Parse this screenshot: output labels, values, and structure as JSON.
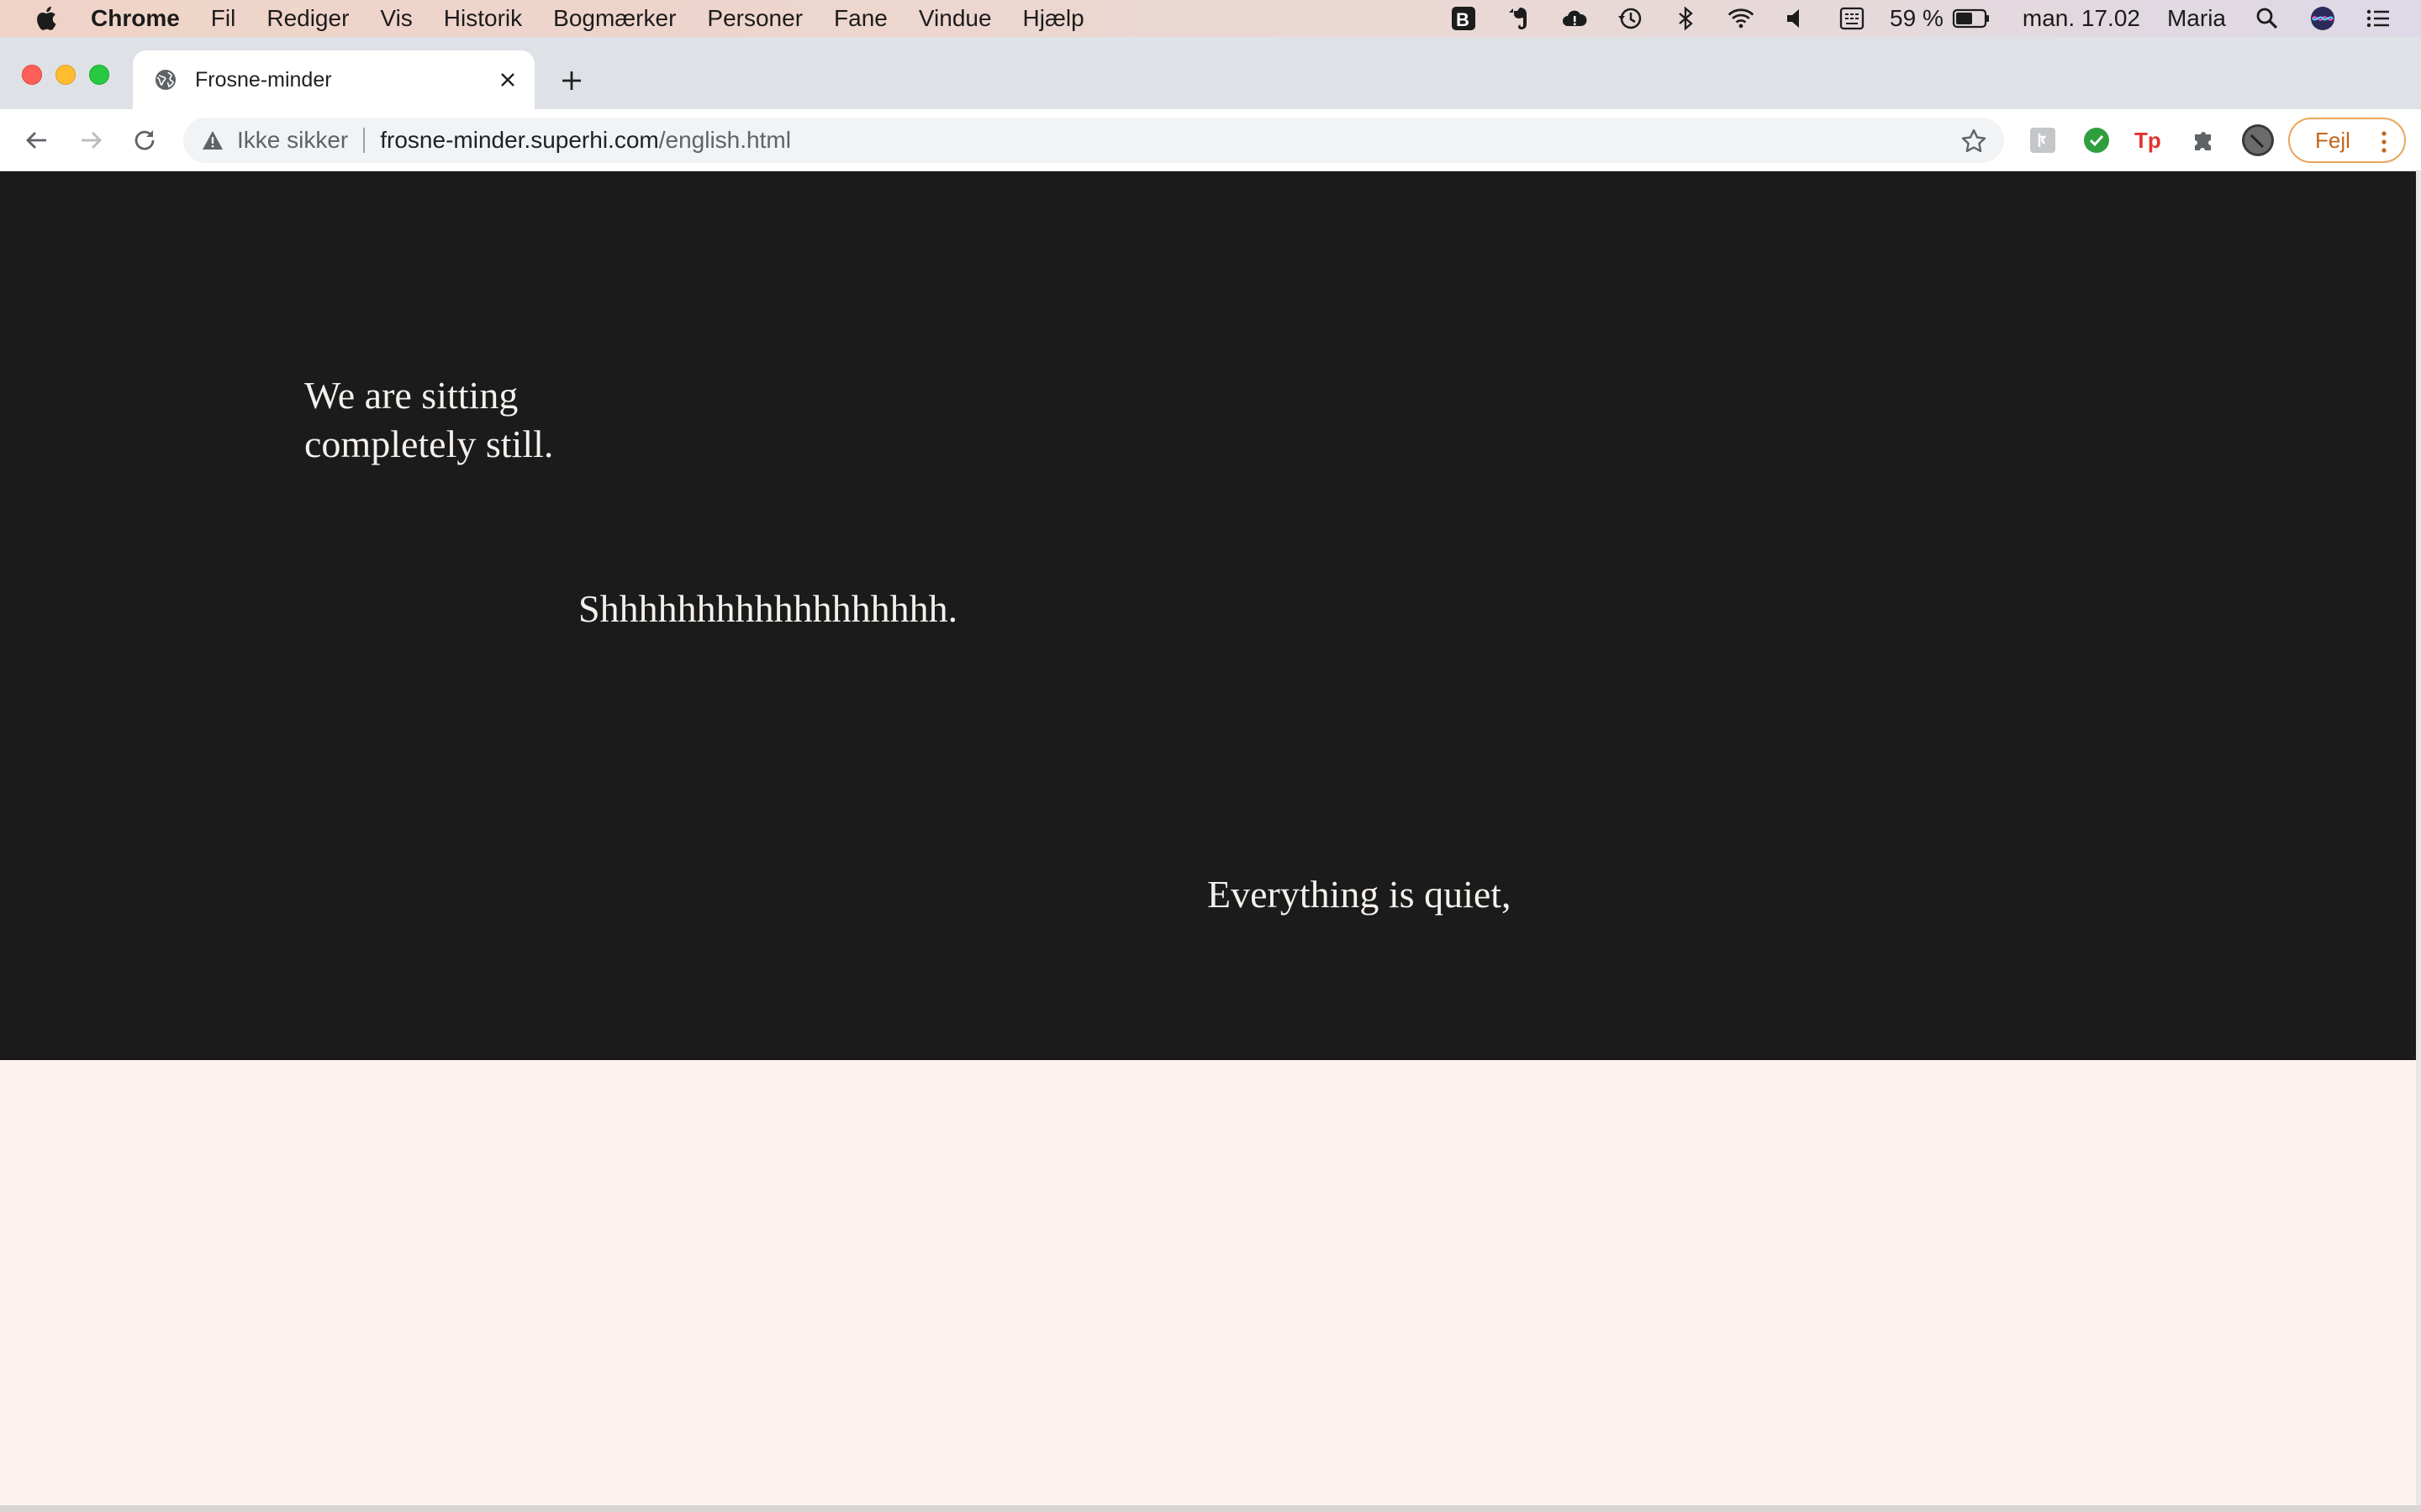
{
  "menubar": {
    "app_name": "Chrome",
    "items": [
      "Fil",
      "Rediger",
      "Vis",
      "Historik",
      "Bogmærker",
      "Personer",
      "Fane",
      "Vindue",
      "Hjælp"
    ],
    "battery": "59 %",
    "clock": "man. 17.02",
    "user": "Maria"
  },
  "tab": {
    "title": "Frosne-minder"
  },
  "address_bar": {
    "security_label": "Ikke sikker",
    "host": "frosne-minder.superhi.com",
    "path": "/english.html"
  },
  "profile_button": {
    "label": "Fejl"
  },
  "page": {
    "line1a": "We are sitting",
    "line1b": "completely still.",
    "line2": "Shhhhhhhhhhhhhhhhhh.",
    "line3": "Everything is quiet,",
    "dark_bg": "#1b1b1b",
    "light_bg": "#fdf2f0"
  },
  "icons": {
    "menubar": [
      "apple-icon",
      "bear-icon",
      "evernote-icon",
      "icloud-icon",
      "time-machine-icon",
      "bluetooth-icon",
      "wifi-icon",
      "volume-icon",
      "keyboard-icon",
      "battery-icon",
      "spotlight-icon",
      "siri-icon",
      "notification-center-icon"
    ],
    "toolbar": [
      "back-icon",
      "forward-icon",
      "reload-icon",
      "warning-icon",
      "bookmark-star-icon",
      "extension-grey-icon",
      "extension-check-icon",
      "extension-tp-icon",
      "extensions-puzzle-icon",
      "profile-avatar-icon",
      "more-vert-icon"
    ]
  }
}
